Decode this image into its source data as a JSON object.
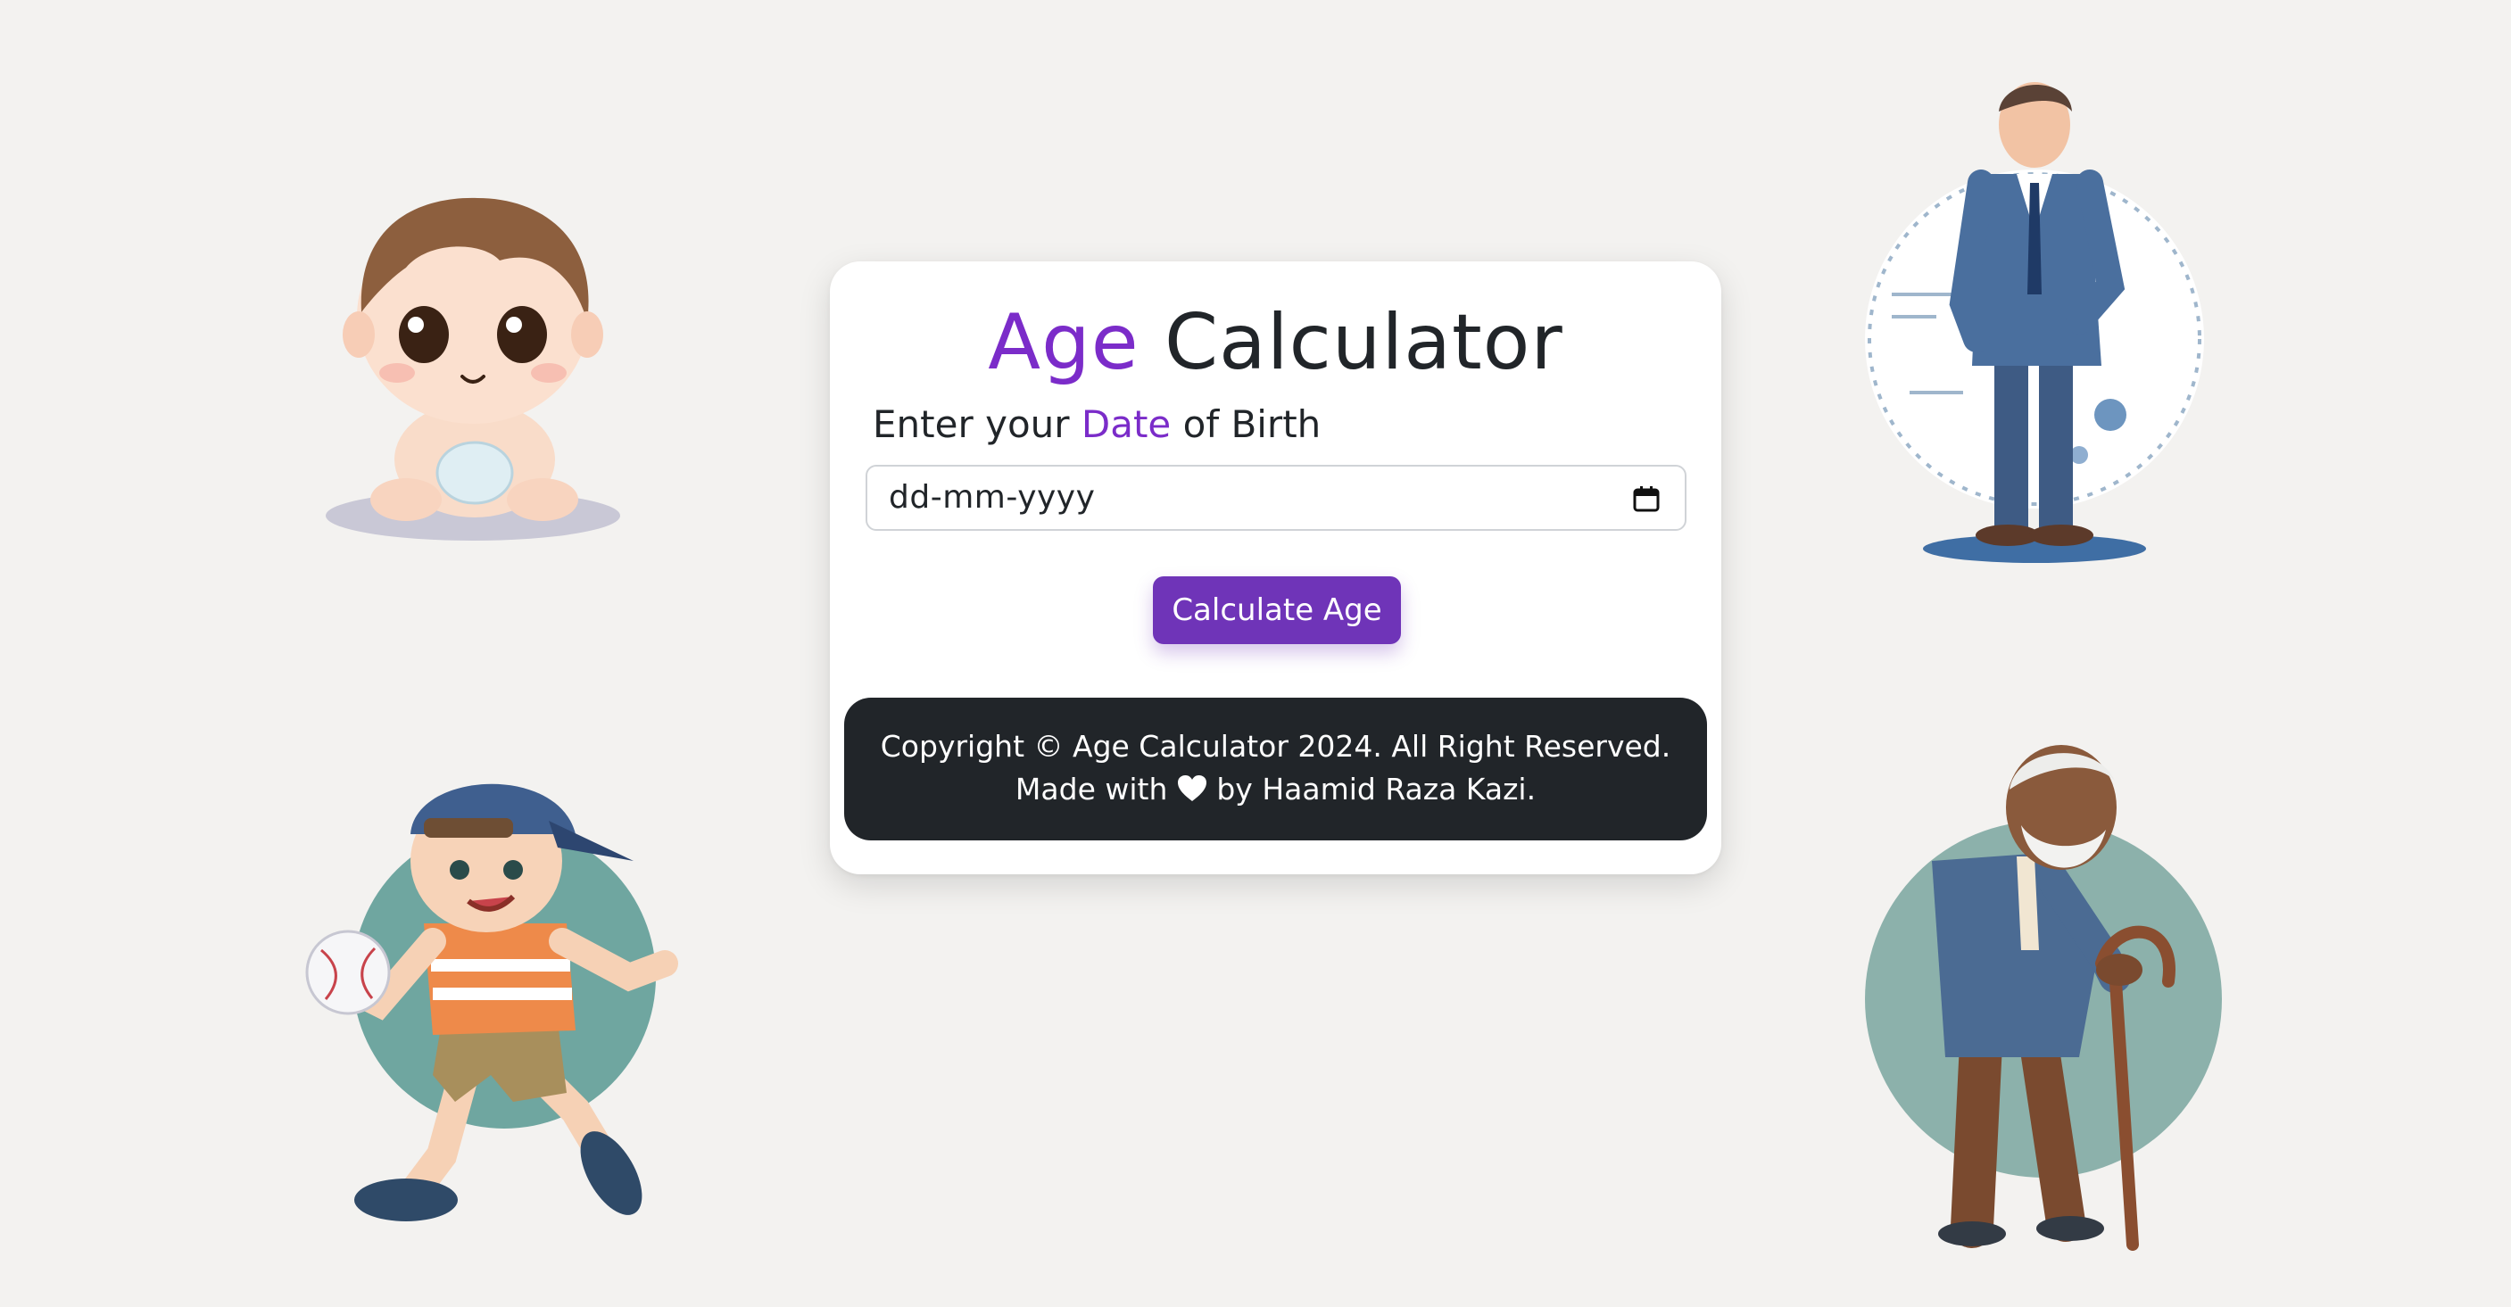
{
  "card": {
    "title_accent": "Age",
    "title_rest": " Calculator",
    "label_prefix": "Enter your ",
    "label_accent": "Date",
    "label_suffix": " of Birth",
    "date_placeholder": "dd-mm-yyyy",
    "calculate_button": "Calculate Age"
  },
  "footer": {
    "copyright": "Copyright © Age Calculator 2024. All Right Reserved.",
    "made_with": "Made with",
    "by_author": " by Haamid Raza Kazi."
  },
  "icons": {
    "calendar": "calendar-icon",
    "heart": "heart-icon"
  },
  "illustrations": [
    "baby-illustration",
    "boy-illustration",
    "man-illustration",
    "elderly-man-illustration"
  ],
  "colors": {
    "accent": "#7b2cc9",
    "button": "#6f34b8",
    "footer_bg": "#212529",
    "page_bg": "#f3f2f0"
  }
}
